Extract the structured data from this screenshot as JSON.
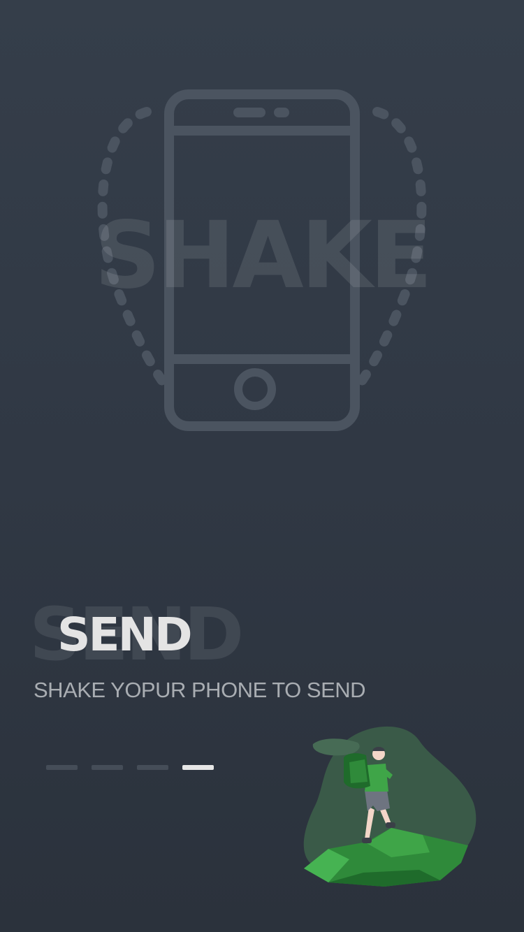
{
  "hero": {
    "watermark_text": "SHAKE",
    "icon": "phone-shake-icon"
  },
  "intro": {
    "watermark_text": "SEND",
    "title": "SEND",
    "subtitle": "SHAKE YOPUR PHONE TO SEND"
  },
  "pager": {
    "total_pages": 4,
    "current_page": 4
  },
  "illustration": {
    "icon": "hiker-illustration"
  },
  "colors": {
    "background_top": "#353e4a",
    "background_bottom": "#2b323c",
    "title": "#e4e4e4",
    "subtitle": "#a9adb2",
    "pager_inactive": "#454d58",
    "pager_active": "#e6e6e6",
    "accent_green": "#3fa548"
  }
}
